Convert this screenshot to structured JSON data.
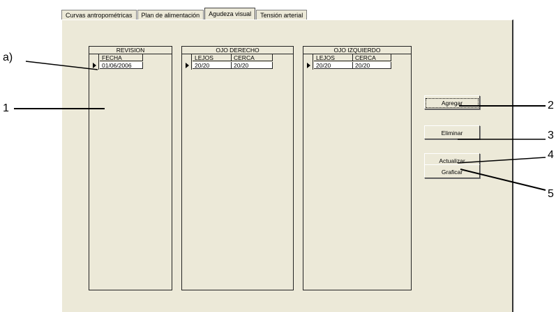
{
  "tabs": [
    {
      "label": "Curvas antropométricas",
      "active": false
    },
    {
      "label": "Plan de alimentación",
      "active": false
    },
    {
      "label": "Agudeza visual",
      "active": true
    },
    {
      "label": "Tensión arterial",
      "active": false
    }
  ],
  "grids": {
    "revision": {
      "title": "REVISION",
      "columns": [
        "FECHA"
      ],
      "rows": [
        [
          "01/06/2006"
        ]
      ]
    },
    "ojo_derecho": {
      "title": "OJO DERECHO",
      "columns": [
        "LEJOS",
        "CERCA"
      ],
      "rows": [
        [
          "20/20",
          "20/20"
        ]
      ]
    },
    "ojo_izquierdo": {
      "title": "OJO IZQUIERDO",
      "columns": [
        "LEJOS",
        "CERCA"
      ],
      "rows": [
        [
          "20/20",
          "20/20"
        ]
      ]
    }
  },
  "buttons": {
    "agregar": "Agregar",
    "eliminar": "Eliminar",
    "actualizar": "Actualizar",
    "graficar": "Graficar"
  },
  "annotations": {
    "a": "a)",
    "n1": "1",
    "n2": "2",
    "n3": "3",
    "n4": "4",
    "n5": "5"
  }
}
